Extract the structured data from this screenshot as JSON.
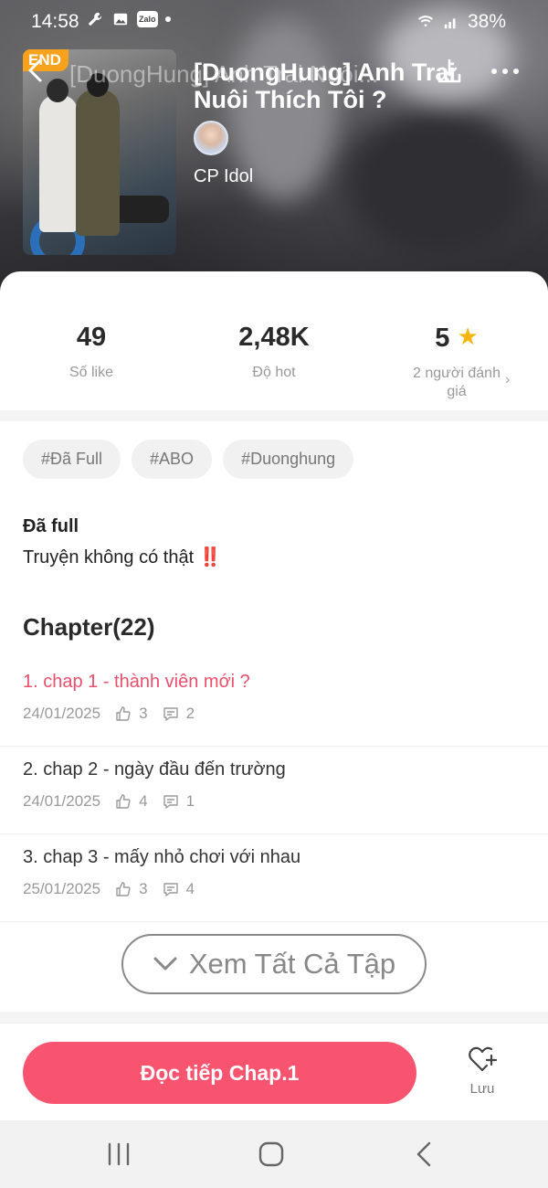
{
  "status_bar": {
    "time": "14:58",
    "zalo_label": "Zalo",
    "battery": "38%"
  },
  "header": {
    "end_badge": "END",
    "ghost_title": "[DuongHung] Anh Trai Nuôi...",
    "title": "[DuongHung] Anh Trai Nuôi Thích Tôi ?",
    "author": "CP Idol"
  },
  "stats": [
    {
      "value": "49",
      "label": "Số like"
    },
    {
      "value": "2,48K",
      "label": "Độ hot"
    },
    {
      "value": "5",
      "label": "2 người đánh giá"
    }
  ],
  "tags": [
    "#Đã Full",
    "#ABO",
    "#Duonghung"
  ],
  "description": {
    "title": "Đã full",
    "text": "Truyện không có thật",
    "mark": "‼️"
  },
  "chapters_heading": "Chapter(22)",
  "chapters": [
    {
      "title": "1. chap 1 - thành viên mới ?",
      "date": "24/01/2025",
      "likes": "3",
      "comments": "2"
    },
    {
      "title": "2. chap 2 - ngày đầu đến trường",
      "date": "24/01/2025",
      "likes": "4",
      "comments": "1"
    },
    {
      "title": "3. chap 3 - mấy nhỏ chơi với nhau",
      "date": "25/01/2025",
      "likes": "3",
      "comments": "4"
    }
  ],
  "see_all_label": "Xem Tất Cả Tập",
  "bottom": {
    "read_label": "Đọc tiếp Chap.1",
    "save_label": "Lưu"
  },
  "colors": {
    "accent": "#f8546f",
    "active_chapter": "#e9506b",
    "star": "#f6b40e",
    "end_badge": "#f6a21c"
  }
}
